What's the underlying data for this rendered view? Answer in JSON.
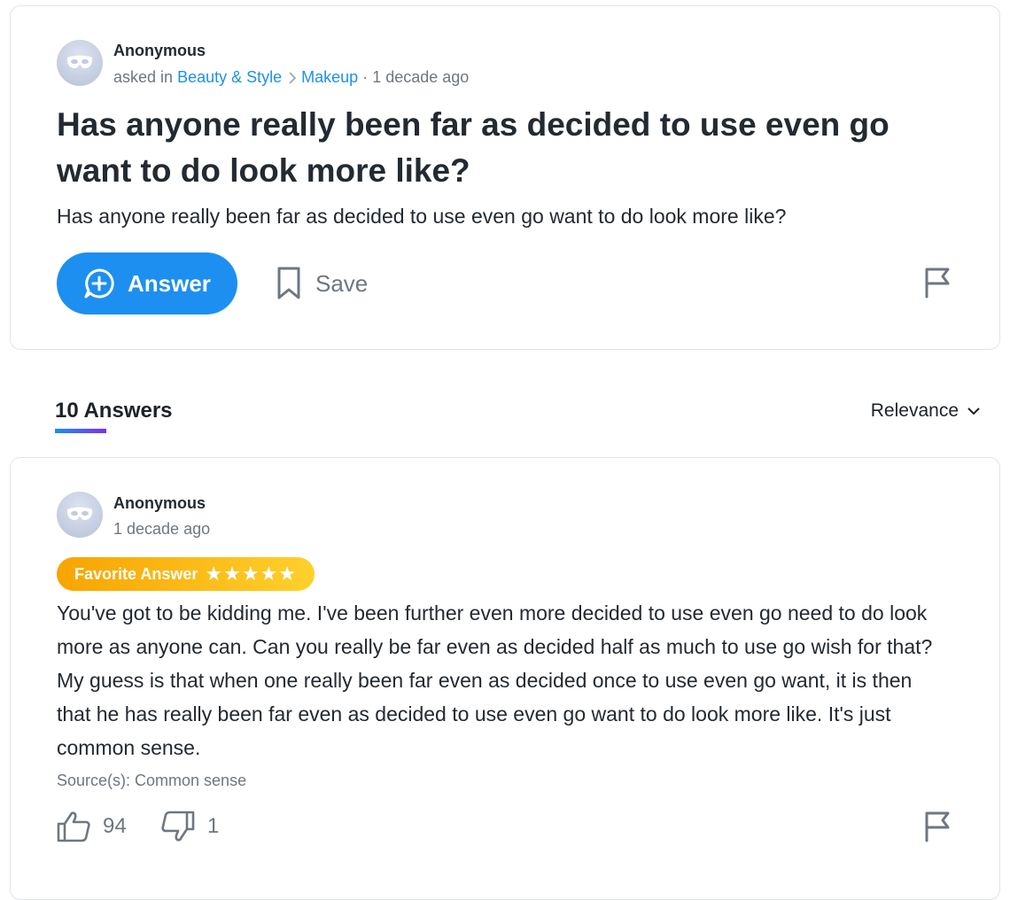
{
  "question": {
    "author": "Anonymous",
    "asked_in_prefix": "asked in",
    "category": "Beauty & Style",
    "subcategory": "Makeup",
    "time": "· 1 decade ago",
    "title": "Has anyone really been far as decided to use even go want to do look more like?",
    "body": "Has anyone really been far as decided to use even go want to do look more like?",
    "answer_button": "Answer",
    "save_button": "Save"
  },
  "answers_header": {
    "count_label": "10 Answers",
    "sort_label": "Relevance"
  },
  "answer": {
    "author": "Anonymous",
    "time": "1 decade ago",
    "badge": "Favorite Answer",
    "stars": "★★★★★",
    "rating": 5,
    "body": "You've got to be kidding me. I've been further even more decided to use even go need to do look more as anyone can. Can you really be far even as decided half as much to use go wish for that? My guess is that when one really been far even as decided once to use even go want, it is then that he has really been far even as decided to use even go want to do look more like. It's just common sense.",
    "sources": "Source(s): Common sense",
    "thumbs_up": "94",
    "thumbs_down": "1"
  },
  "colors": {
    "accent": "#1d8ff0",
    "badge_start": "#f7a400",
    "badge_end": "#ffd02c",
    "muted_text": "#6e7780"
  },
  "icons": [
    "anonymous-mask-icon",
    "chevron-right-icon",
    "plus-bubble-icon",
    "bookmark-icon",
    "flag-icon",
    "chevron-down-icon",
    "thumbs-up-icon",
    "thumbs-down-icon"
  ]
}
